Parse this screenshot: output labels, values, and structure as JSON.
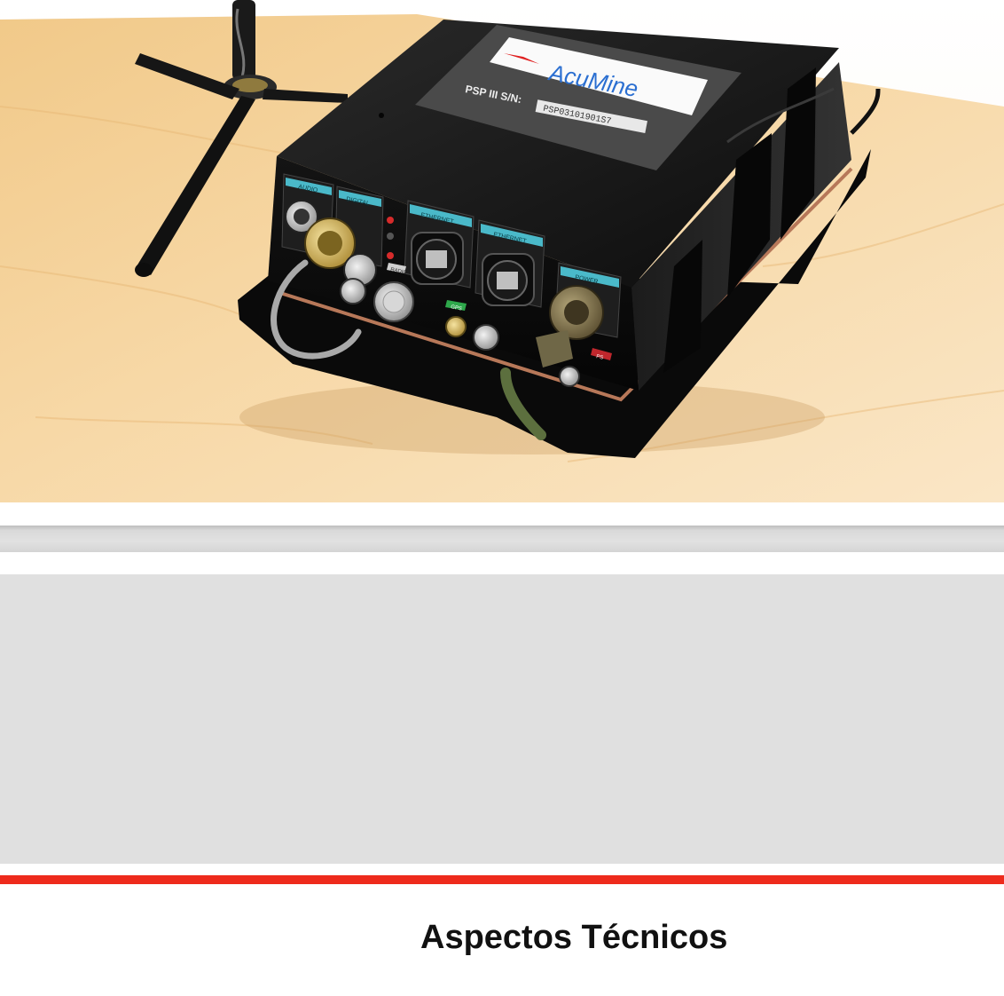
{
  "cover_photo": {
    "logo_text": "AcuMine",
    "serial_label": "PSP III S/N:",
    "serial_value": "PSP03101901S7",
    "port_labels": [
      "AUDIO",
      "DIGITAL",
      "RADIO",
      "ETHERNET",
      "ETHERNET",
      "GPS",
      "POWER",
      "PS"
    ]
  },
  "title": "Aspectos Técnicos",
  "colors": {
    "accent_red": "#ee2a1c",
    "band_gray": "#e0e0e0",
    "title_text": "#111111"
  }
}
